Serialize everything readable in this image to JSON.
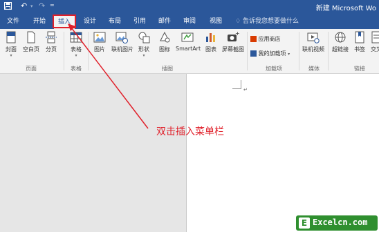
{
  "titlebar": {
    "save_icon": "save-icon",
    "undo_icon": "undo-icon",
    "redo_icon": "redo-icon",
    "title": "新建 Microsoft Wo"
  },
  "tabs": [
    {
      "label": "文件"
    },
    {
      "label": "开始"
    },
    {
      "label": "插入"
    },
    {
      "label": "设计"
    },
    {
      "label": "布局"
    },
    {
      "label": "引用"
    },
    {
      "label": "邮件"
    },
    {
      "label": "审阅"
    },
    {
      "label": "视图"
    }
  ],
  "active_tab": "插入",
  "tellme": {
    "icon": "lightbulb-icon",
    "placeholder": "告诉我您想要做什么"
  },
  "ribbon": {
    "pages": {
      "cover": "封面",
      "blank": "空白页",
      "break": "分页",
      "group": "页面"
    },
    "tables": {
      "table": "表格",
      "group": "表格"
    },
    "illustrations": {
      "picture": "图片",
      "online_picture": "联机图片",
      "shapes": "形状",
      "icons": "图标",
      "smartart": "SmartArt",
      "chart": "图表",
      "screenshot": "屏幕截图",
      "group": "插图"
    },
    "addins": {
      "store": "应用商店",
      "my_addins": "我的加载项",
      "group": "加载项"
    },
    "media": {
      "online_video": "联机视频",
      "group": "媒体"
    },
    "links": {
      "link": "超链接",
      "bookmark": "书签",
      "cross_ref": "交叉",
      "group": "链接"
    }
  },
  "annotation": "双击插入菜单栏",
  "watermark": {
    "letter": "E",
    "text": "Excelcn.com"
  },
  "colors": {
    "brand": "#2b579a",
    "annotation": "#e0202a",
    "watermark": "#2f8f2f"
  }
}
